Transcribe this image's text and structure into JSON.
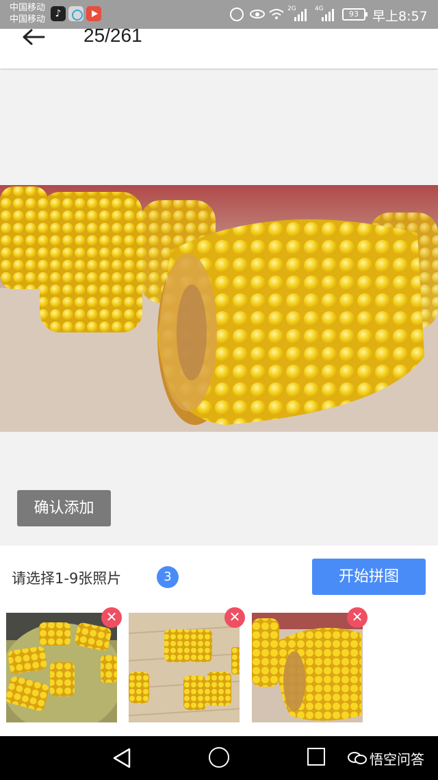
{
  "status_bar": {
    "carrier_1": "中国移动",
    "carrier_2": "中国移动",
    "net_1": "2G",
    "net_2": "4G",
    "battery": "93",
    "time": "早上8:57",
    "icons": [
      "tiktok-icon",
      "music-icon",
      "video-icon",
      "alarm-icon",
      "eye-icon",
      "wifi-icon",
      "signal-icon",
      "battery-icon"
    ]
  },
  "header": {
    "counter": "25/261"
  },
  "preview": {
    "confirm_label": "确认添加"
  },
  "panel": {
    "hint": "请选择1-9张照片",
    "selected_count": "3",
    "start_label": "开始拼图",
    "thumbnails": [
      {
        "name": "corn-in-water"
      },
      {
        "name": "corn-on-board"
      },
      {
        "name": "corn-closeup"
      }
    ],
    "remove_symbol": "✕"
  },
  "watermark": {
    "text": "悟空问答"
  },
  "colors": {
    "accent_blue": "#4a8cf7",
    "remove_red": "#ef4f62",
    "confirm_gray": "#7a7a7a"
  }
}
